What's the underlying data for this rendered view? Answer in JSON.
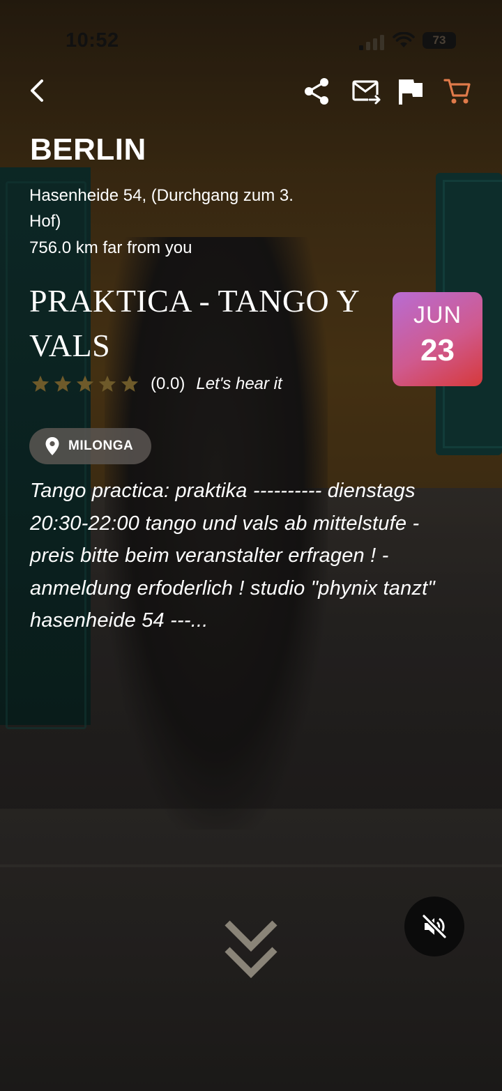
{
  "status_bar": {
    "time": "10:52",
    "battery": "73",
    "icons": [
      "signal-icon",
      "wifi-icon",
      "battery-icon"
    ]
  },
  "toolbar": {
    "icons": [
      "back-arrow-icon",
      "share-icon",
      "mail-forward-icon",
      "flag-icon",
      "cart-icon"
    ],
    "cart_color": "#E07A4A"
  },
  "event": {
    "city": "BERLIN",
    "address": "Hasenheide 54, (Durchgang zum 3. Hof)",
    "distance": "756.0 km far from you",
    "title": "PRAKTICA - TANGO Y VALS",
    "date": {
      "month": "JUN",
      "day": "23"
    },
    "rating": {
      "stars": 0,
      "max": 5,
      "value": "(0.0)",
      "cta": "Let's hear it"
    },
    "category": "MILONGA",
    "description": "Tango practica: praktika ---------- dienstags 20:30-22:00 tango und vals ab mittelstufe - preis bitte beim veranstalter erfragen ! - anmeldung erfoderlich ! studio \"phynix tanzt\" hasenheide 54 ---..."
  },
  "colors": {
    "star": "#6E5A2A",
    "badge_gradient_start": "#B86CD3",
    "badge_gradient_end": "#D6393A",
    "chip_bg": "#5A5652"
  },
  "controls": {
    "scroll_icon": "double-chevron-down-icon",
    "mute_icon": "volume-off-icon"
  }
}
